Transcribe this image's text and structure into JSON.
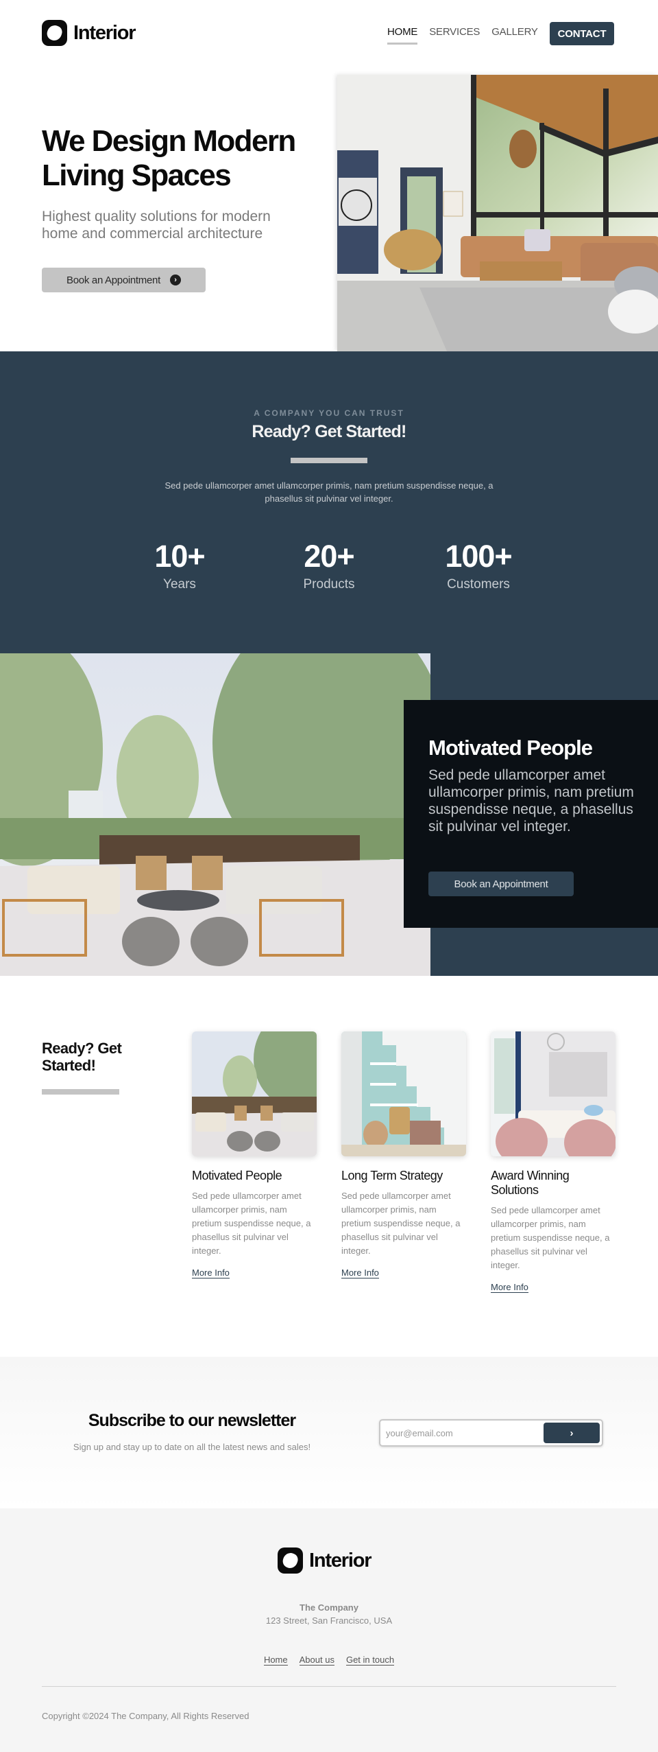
{
  "brand": {
    "name": "Interior",
    "logo_icon": "blob-logo-icon"
  },
  "colors": {
    "primary": "#2d4050",
    "dark_card": "#0b1015",
    "muted_gray": "#c4c4c4",
    "footer_bg": "#f5f5f5"
  },
  "nav": {
    "items": [
      {
        "label": "HOME",
        "active": true
      },
      {
        "label": "SERVICES",
        "active": false
      },
      {
        "label": "GALLERY",
        "active": false
      }
    ],
    "contact_label": "CONTACT"
  },
  "hero": {
    "title": "We Design Modern Living Spaces",
    "subtitle": "Highest quality solutions for modern home and commercial architecture",
    "button_label": "Book an Appointment",
    "button_icon": "chevron-right-circle-icon",
    "image_alt": "Modern living room with leather sectional sofa and large windows"
  },
  "trust": {
    "eyebrow": "A COMPANY YOU CAN TRUST",
    "title": "Ready? Get Started!",
    "description": "Sed pede ullamcorper amet ullamcorper primis, nam pretium suspendisse neque, a phasellus sit pulvinar vel integer.",
    "stats": [
      {
        "value": "10+",
        "label": "Years"
      },
      {
        "value": "20+",
        "label": "Products"
      },
      {
        "value": "100+",
        "label": "Customers"
      }
    ]
  },
  "feature": {
    "image_alt": "Outdoor terrace lounge with sofas and ottomans",
    "title": "Motivated People",
    "text": "Sed pede ullamcorper amet ullamcorper primis, nam pretium suspendisse neque, a phasellus sit pulvinar vel integer.",
    "button_label": "Book an Appointment"
  },
  "services": {
    "heading": "Ready? Get Started!",
    "cards": [
      {
        "title": "Motivated People",
        "text": "Sed pede ullamcorper amet ullamcorper primis, nam pretium suspendisse neque, a phasellus sit pulvinar vel integer.",
        "link": "More Info",
        "image_alt": "Terrace lounge"
      },
      {
        "title": "Long Term Strategy",
        "text": "Sed pede ullamcorper amet ullamcorper primis, nam pretium suspendisse neque, a phasellus sit pulvinar vel integer.",
        "link": "More Info",
        "image_alt": "Under-stairs home office"
      },
      {
        "title": "Award Winning Solutions",
        "text": "Sed pede ullamcorper amet ullamcorper primis, nam pretium suspendisse neque, a phasellus sit pulvinar vel integer.",
        "link": "More Info",
        "image_alt": "Living room with pink armchairs"
      }
    ]
  },
  "newsletter": {
    "title": "Subscribe to our newsletter",
    "subtitle": "Sign up and stay up to date on all the latest news and sales!",
    "email_value": "",
    "email_placeholder": "your@email.com",
    "submit_icon": "chevron-right-icon"
  },
  "footer": {
    "company": "The Company",
    "address": "123 Street, San Francisco, USA",
    "links": [
      "Home",
      "About us",
      "Get in touch"
    ],
    "copyright": "Copyright ©2024 The Company, All Rights Reserved"
  }
}
